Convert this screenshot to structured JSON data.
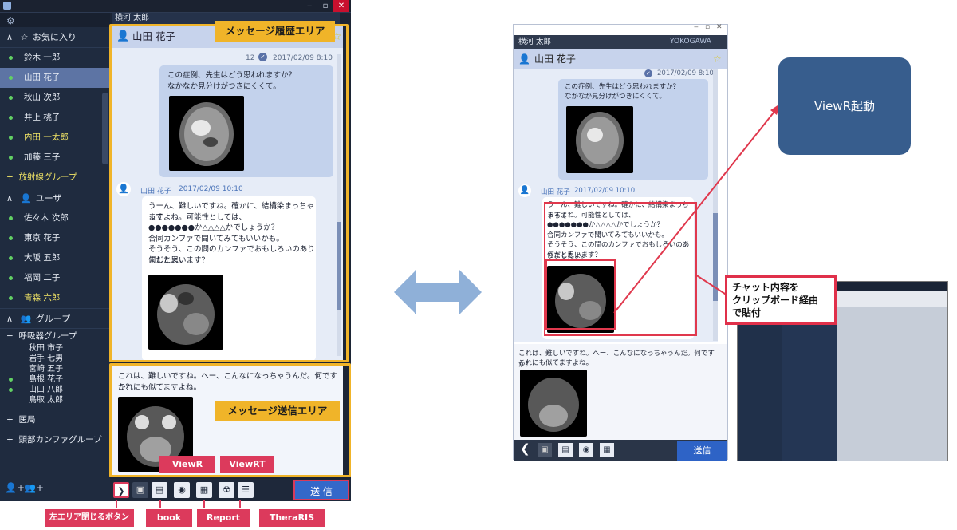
{
  "left_app": {
    "current_user": "横河 太郎",
    "sidebar": {
      "favorites_title": "お気に入り",
      "favorites": [
        {
          "name": "鈴木 一郎",
          "online": true,
          "highlight": false,
          "selected": false
        },
        {
          "name": "山田 花子",
          "online": true,
          "highlight": false,
          "selected": true
        },
        {
          "name": "秋山 次郎",
          "online": true,
          "highlight": false,
          "selected": false
        },
        {
          "name": "井上 桃子",
          "online": true,
          "highlight": false,
          "selected": false
        },
        {
          "name": "内田 一太郎",
          "online": true,
          "highlight": true,
          "selected": false
        },
        {
          "name": "加藤 三子",
          "online": true,
          "highlight": false,
          "selected": false
        }
      ],
      "favorites_group": "放射線グループ",
      "users_title": "ユーザ",
      "users": [
        {
          "name": "佐々木 次郎",
          "online": true,
          "highlight": false
        },
        {
          "name": "東京 花子",
          "online": true,
          "highlight": false
        },
        {
          "name": "大阪 五郎",
          "online": true,
          "highlight": false
        },
        {
          "name": "福岡 二子",
          "online": true,
          "highlight": false
        },
        {
          "name": "青森 六郎",
          "online": true,
          "highlight": true
        }
      ],
      "groups_title": "グループ",
      "group_expanded": "呼吸器グループ",
      "group_members": [
        {
          "name": "秋田 市子",
          "online": false
        },
        {
          "name": "岩手 七男",
          "online": false
        },
        {
          "name": "宮崎 五子",
          "online": false
        },
        {
          "name": "島根 花子",
          "online": true
        },
        {
          "name": "山口 八郎",
          "online": true
        },
        {
          "name": "鳥取 太郎",
          "online": false
        }
      ],
      "group_collapsed": [
        "医局",
        "頭部カンファグループ"
      ]
    },
    "chat": {
      "partner": "山田 花子",
      "msg1": {
        "count": "12",
        "timestamp": "2017/02/09 8:10",
        "lines": [
          "この症例、先生はどう思われますか？",
          "なかなか見分けがつきにくくて。"
        ]
      },
      "msg2": {
        "sender": "山田 花子",
        "timestamp": "2017/02/09 10:10",
        "lines": [
          "うーん、難しいですね。確かに、結構染まっちゃって",
          "ますよね。可能性としては、",
          "●●●●●●●か△△△△かでしょうか？",
          "合同カンファで聞いてみてもいいかも。",
          "そうそう、この間のカンファでおもしろいのありましたよ。",
          "何だと思います？"
        ]
      },
      "draft_lines": [
        "これは、難しいですね。へー、こんなになっちゃうんだ。何ですか？",
        "これにも似てますよね。"
      ]
    },
    "annotations": {
      "history_area": "メッセージ履歴エリア",
      "send_area": "メッセージ送信エリア",
      "viewr": "ViewR",
      "viewrt": "ViewRT",
      "close_left": "左エリア閉じるボタン",
      "book": "book",
      "report": "Report",
      "theraris": "TheraRIS"
    },
    "send_button": "送 信"
  },
  "right_app": {
    "current_user": "横河 太郎",
    "brand": "YOKOGAWA",
    "partner": "山田 花子",
    "msg1_timestamp": "2017/02/09 8:10",
    "msg1_lines": [
      "この症例、先生はどう思われますか？",
      "なかなか見分けがつきにくくて。"
    ],
    "msg2_sender": "山田 花子",
    "msg2_timestamp": "2017/02/09 10:10",
    "msg2_lines": [
      "うーん、難しいですね。確かに、結構染まっちゃって",
      "ますよね。可能性としては、",
      "●●●●●●●か△△△△かでしょうか？",
      "合同カンファで聞いてみてもいいかも。",
      "そうそう、この間のカンファでおもしろいのありましたよ。",
      "何だと思います？"
    ],
    "draft_lines": [
      "これは、難しいですね。へー、こんなになっちゃうんだ。何ですか？",
      "これにも似てますよね。"
    ],
    "send_button": "送信"
  },
  "callouts": {
    "viewr_launch": "ViewR起動",
    "clipboard": [
      "チャット内容を",
      "クリップボード経由",
      "で貼付"
    ]
  },
  "colors": {
    "accent_orange": "#f0b429",
    "accent_pink": "#dc3a5c",
    "send_blue": "#3468c9",
    "online_green": "#62d064"
  }
}
